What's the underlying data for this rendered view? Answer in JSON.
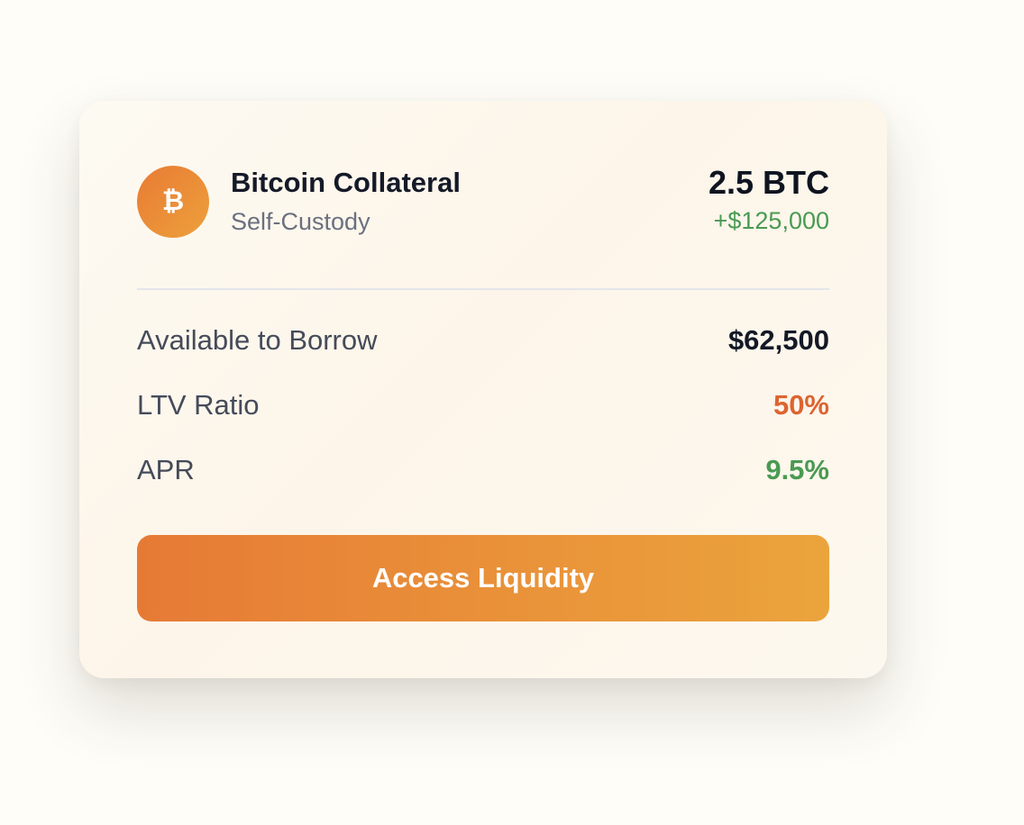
{
  "asset": {
    "icon": "bitcoin-icon",
    "icon_glyph": "₿",
    "name": "Bitcoin Collateral",
    "custody": "Self-Custody",
    "amount": "2.5 BTC",
    "usd_value": "+$125,000"
  },
  "stats": [
    {
      "label": "Available to Borrow",
      "value": "$62,500",
      "color": "#141926"
    },
    {
      "label": "LTV Ratio",
      "value": "50%",
      "color": "#dd6430"
    },
    {
      "label": "APR",
      "value": "9.5%",
      "color": "#4a9a52"
    }
  ],
  "action": {
    "label": "Access Liquidity"
  },
  "colors": {
    "accent_start": "#e67a35",
    "accent_end": "#eba43c",
    "positive": "#4a9a52"
  }
}
